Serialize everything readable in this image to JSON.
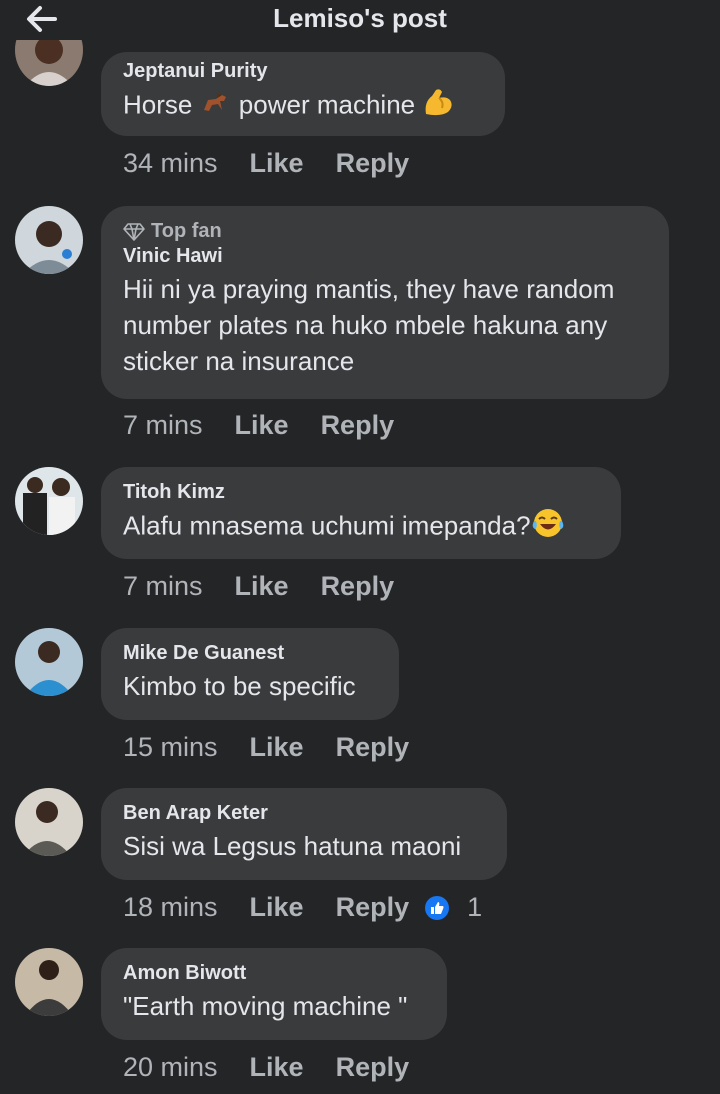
{
  "header": {
    "title": "Lemiso's post",
    "back_icon": "arrow-left-icon"
  },
  "comments": [
    {
      "author": "Jeptanui Purity",
      "text_parts": [
        "Horse ",
        " power machine "
      ],
      "time": "34 mins",
      "like": "Like",
      "reply": "Reply"
    },
    {
      "top_fan": "Top fan",
      "author": "Vinic Hawi",
      "lines": [
        "Hii ni ya praying mantis, they have random",
        "number plates na huko mbele hakuna any",
        "sticker na insurance"
      ],
      "time": "7 mins",
      "like": "Like",
      "reply": "Reply"
    },
    {
      "author": "Titoh Kimz",
      "text": "Alafu mnasema uchumi imepanda?",
      "time": "7 mins",
      "like": "Like",
      "reply": "Reply"
    },
    {
      "author": "Mike De Guanest",
      "text": "Kimbo to be specific",
      "time": "15 mins",
      "like": "Like",
      "reply": "Reply"
    },
    {
      "author": "Ben Arap Keter",
      "text": "Sisi wa Legsus hatuna maoni",
      "time": "18 mins",
      "like": "Like",
      "reply": "Reply",
      "reaction_count": "1"
    },
    {
      "author": "Amon Biwott",
      "text": "\"Earth moving machine \"",
      "time": "20 mins",
      "like": "Like",
      "reply": "Reply"
    }
  ],
  "colors": {
    "background": "#242526",
    "bubble": "#3a3b3c",
    "text": "#e4e6eb",
    "muted": "#b0b3b8",
    "like_blue": "#1877f2"
  }
}
